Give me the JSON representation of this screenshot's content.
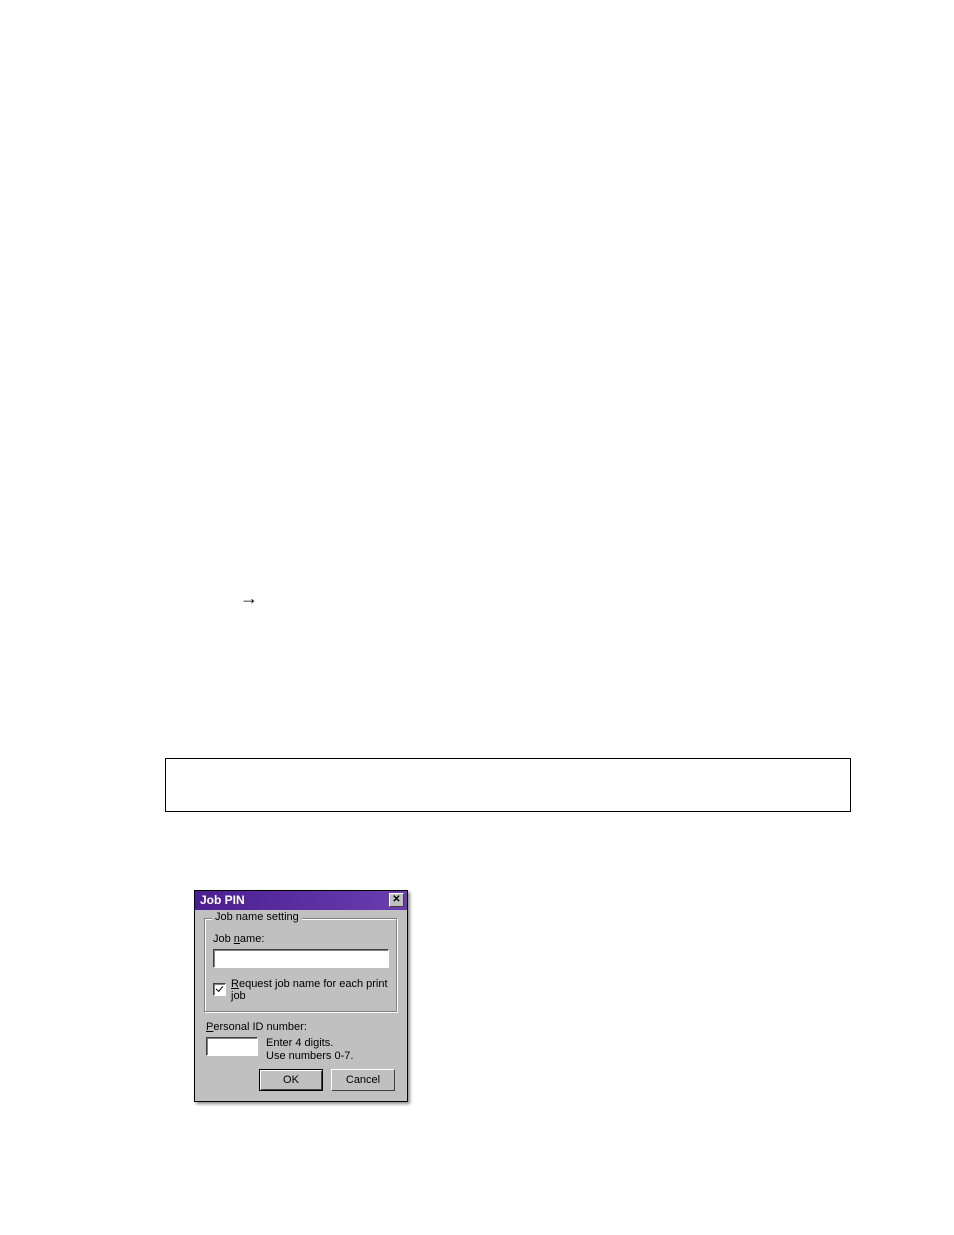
{
  "arrow_char": "→",
  "dialog": {
    "title": "Job PIN",
    "close_label": "✕",
    "groupbox_legend": "Job name setting",
    "job_name_label_pre": "Job ",
    "job_name_label_u": "n",
    "job_name_label_post": "ame:",
    "job_name_value": "",
    "request_checkbox_checked": true,
    "request_label_u": "R",
    "request_label_post": "equest job name for each print job",
    "pin_label_u": "P",
    "pin_label_post": "ersonal ID number:",
    "pin_value": "",
    "pin_hint_line1": "Enter 4 digits.",
    "pin_hint_line2": "Use numbers 0-7.",
    "ok_label": "OK",
    "cancel_label": "Cancel"
  }
}
